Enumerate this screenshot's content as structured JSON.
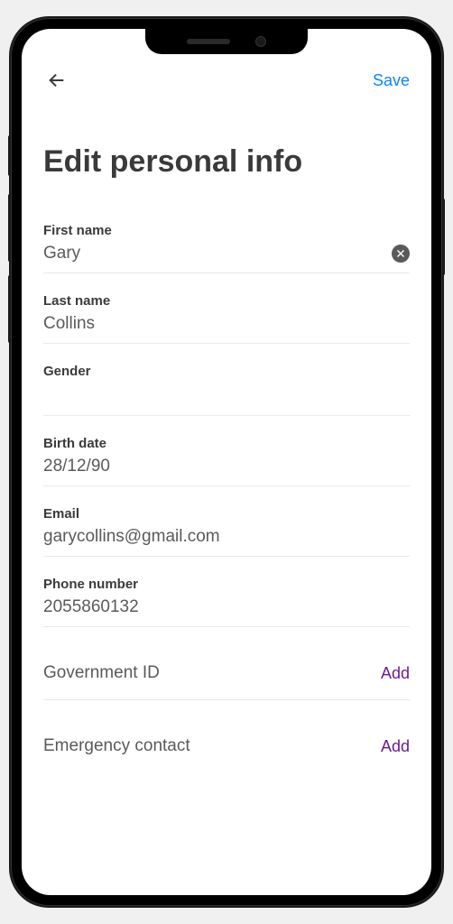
{
  "header": {
    "save_label": "Save"
  },
  "title": "Edit personal info",
  "fields": {
    "first_name": {
      "label": "First name",
      "value": "Gary"
    },
    "last_name": {
      "label": "Last name",
      "value": "Collins"
    },
    "gender": {
      "label": "Gender",
      "value": ""
    },
    "birth_date": {
      "label": "Birth date",
      "value": "28/12/90"
    },
    "email": {
      "label": "Email",
      "value": "garycollins@gmail.com"
    },
    "phone": {
      "label": "Phone number",
      "value": "2055860132"
    }
  },
  "links": {
    "gov_id": {
      "label": "Government ID",
      "action": "Add"
    },
    "emergency": {
      "label": "Emergency contact",
      "action": "Add"
    }
  }
}
